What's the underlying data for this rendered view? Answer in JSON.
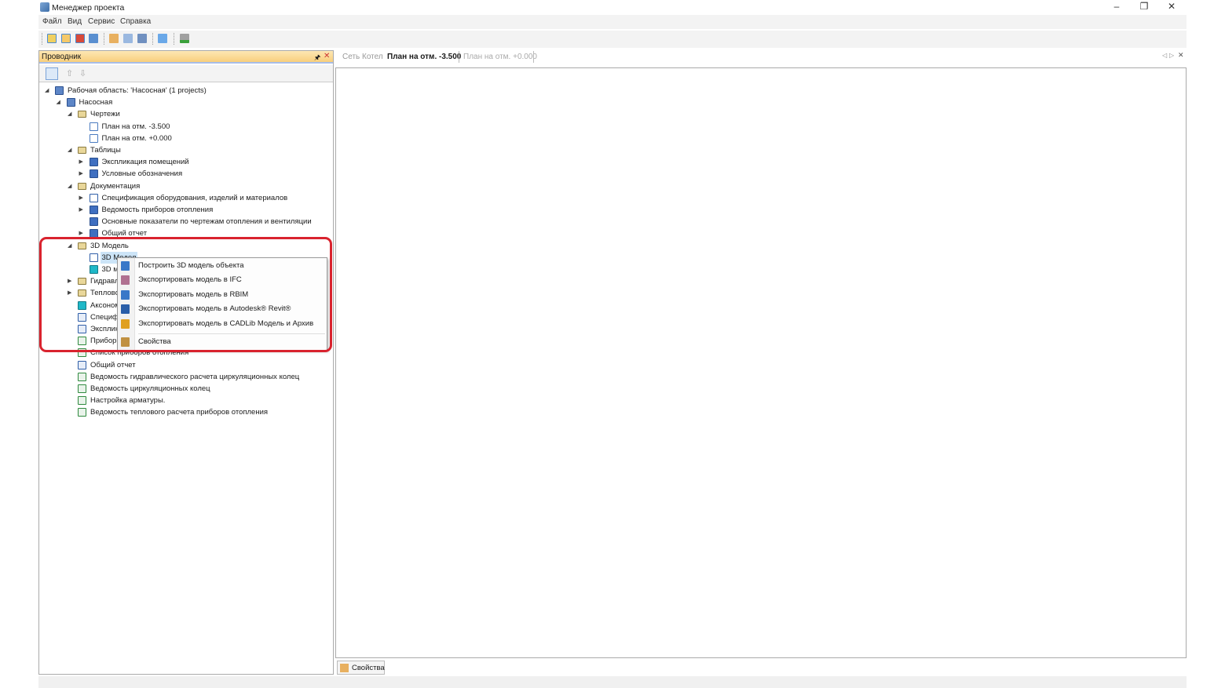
{
  "window": {
    "title": "Менеджер проекта",
    "minimize": "–",
    "restore": "❐",
    "close": "✕"
  },
  "menu": [
    "Файл",
    "Вид",
    "Сервис",
    "Справка"
  ],
  "explorer": {
    "title": "Проводник",
    "pin": "🖈",
    "close": "✕",
    "tree": [
      {
        "label": "Рабочая область: 'Насосная' (1 projects)",
        "level": 0,
        "arrow": "expanded",
        "icon": "workspace"
      },
      {
        "label": "Насосная",
        "level": 1,
        "arrow": "expanded",
        "icon": "project"
      },
      {
        "label": "Чертежи",
        "level": 2,
        "arrow": "expanded",
        "icon": "folder"
      },
      {
        "label": "План на отм. -3.500",
        "level": 3,
        "arrow": "none",
        "icon": "plan"
      },
      {
        "label": "План на отм. +0.000",
        "level": 3,
        "arrow": "none",
        "icon": "plan"
      },
      {
        "label": "Таблицы",
        "level": 2,
        "arrow": "expanded",
        "icon": "folder"
      },
      {
        "label": "Экспликация помещений",
        "level": 3,
        "arrow": "collapsed",
        "icon": "table"
      },
      {
        "label": "Условные обозначения",
        "level": 3,
        "arrow": "collapsed",
        "icon": "table"
      },
      {
        "label": "Документация",
        "level": 2,
        "arrow": "expanded",
        "icon": "folder"
      },
      {
        "label": "Спецификация оборудования, изделий и материалов",
        "level": 3,
        "arrow": "collapsed",
        "icon": "doc"
      },
      {
        "label": "Ведомость приборов отопления",
        "level": 3,
        "arrow": "collapsed",
        "icon": "table"
      },
      {
        "label": "Основные показатели по чертежам отопления и вентиляции",
        "level": 3,
        "arrow": "none",
        "icon": "table"
      },
      {
        "label": "Общий отчет",
        "level": 3,
        "arrow": "collapsed",
        "icon": "table"
      },
      {
        "label": "3D Модель",
        "level": 2,
        "arrow": "expanded",
        "icon": "folder"
      },
      {
        "label": "3D Модел",
        "level": 3,
        "arrow": "none",
        "icon": "doc",
        "selected": true
      },
      {
        "label": "3D м",
        "level": 3,
        "arrow": "none",
        "icon": "teal"
      },
      {
        "label": "Гидравл",
        "level": 2,
        "arrow": "collapsed",
        "icon": "folder"
      },
      {
        "label": "Теплово",
        "level": 2,
        "arrow": "collapsed",
        "icon": "folder"
      },
      {
        "label": "Аксоном",
        "level": 2,
        "arrow": "none",
        "icon": "teal"
      },
      {
        "label": "Специф",
        "level": 2,
        "arrow": "none",
        "icon": "word"
      },
      {
        "label": "Эксплик",
        "level": 2,
        "arrow": "none",
        "icon": "word"
      },
      {
        "label": "Прибор",
        "level": 2,
        "arrow": "none",
        "icon": "xls"
      },
      {
        "label": "Список приборов отопления",
        "level": 2,
        "arrow": "none",
        "icon": "xls"
      },
      {
        "label": "Общий отчет",
        "level": 2,
        "arrow": "none",
        "icon": "word"
      },
      {
        "label": "Ведомость гидравлического расчета циркуляционных колец",
        "level": 2,
        "arrow": "none",
        "icon": "xls"
      },
      {
        "label": "Ведомость циркуляционных колец",
        "level": 2,
        "arrow": "none",
        "icon": "xls"
      },
      {
        "label": "Настройка арматуры.",
        "level": 2,
        "arrow": "none",
        "icon": "xls"
      },
      {
        "label": "Ведомость теплового расчета приборов отопления",
        "level": 2,
        "arrow": "none",
        "icon": "xls"
      }
    ]
  },
  "doc_tabs": [
    {
      "label": "Сеть Котел",
      "active": false
    },
    {
      "label": "План на отм. -3.500",
      "active": true
    },
    {
      "label": "План на отм. +0.000",
      "active": false
    }
  ],
  "context_menu": [
    {
      "label": "Построить 3D модель объекта",
      "icon": "build-3d-icon",
      "color": "#3a78c8"
    },
    {
      "label": "Экспортировать модель в IFC",
      "icon": "ifc-icon",
      "color": "#b07090"
    },
    {
      "label": "Экспортировать модель в RBIM",
      "icon": "rbim-icon",
      "color": "#3a78c8"
    },
    {
      "label": "Экспортировать модель в Autodesk® Revit®",
      "icon": "revit-icon",
      "color": "#2a5ea8"
    },
    {
      "label": "Экспортировать модель в CADLib Модель и Архив",
      "icon": "cadlib-icon",
      "color": "#e0a020"
    },
    {
      "label": "Свойства",
      "icon": "properties-icon",
      "color": "#c09040"
    }
  ],
  "bottom_tab": "Свойства",
  "colors": {
    "highlight": "#d9232e",
    "selection": "#cce4f7",
    "panel_header": "#f8cf7c"
  }
}
